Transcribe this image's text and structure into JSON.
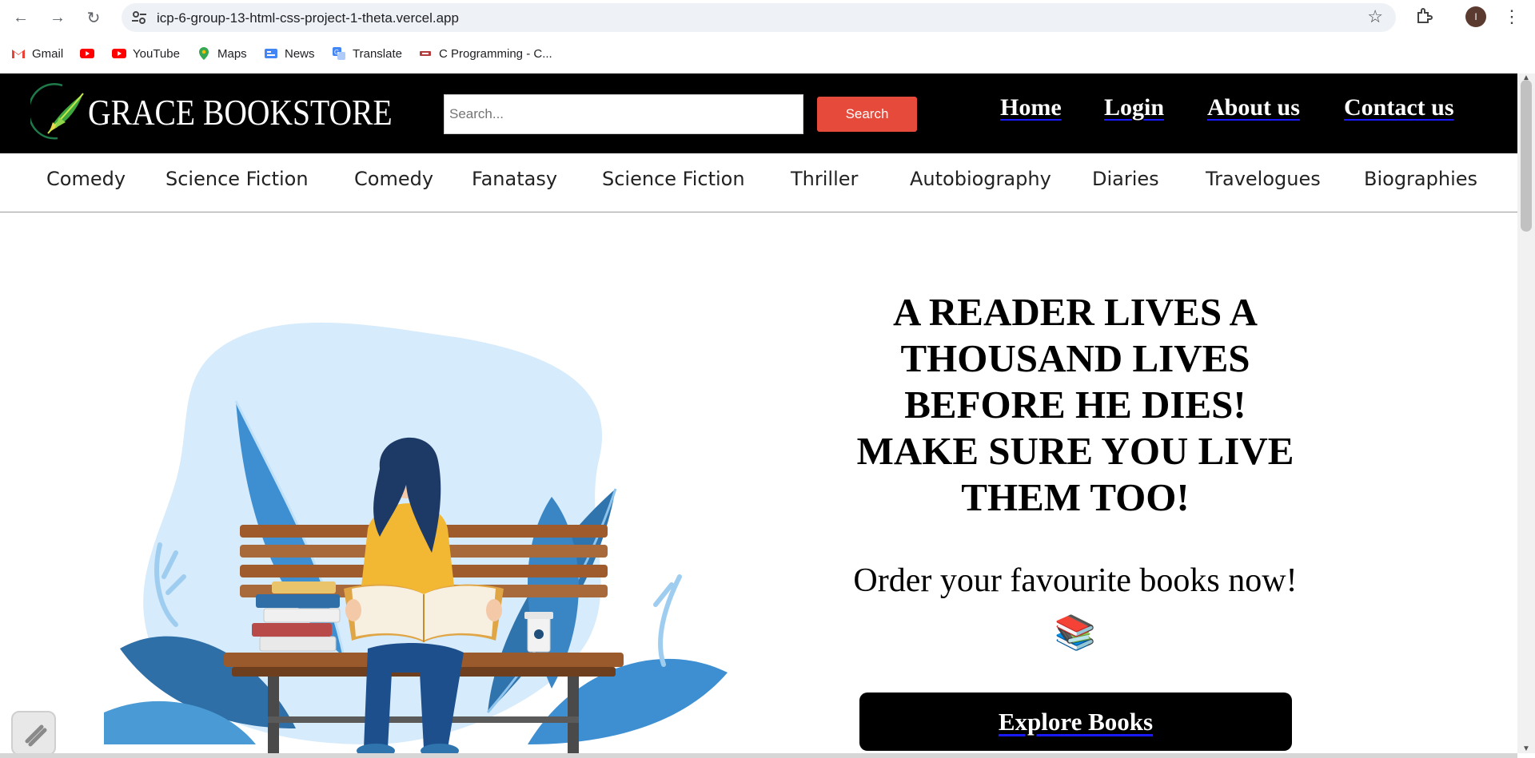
{
  "browser": {
    "url": "icp-6-group-13-html-css-project-1-theta.vercel.app",
    "avatar_initial": "I",
    "bookmarks": [
      {
        "label": "Gmail",
        "icon": "gmail-icon",
        "color": "#ea4335"
      },
      {
        "label": "",
        "icon": "youtube-icon",
        "color": "#ff0000"
      },
      {
        "label": "YouTube",
        "icon": "youtube-icon",
        "color": "#ff0000"
      },
      {
        "label": "Maps",
        "icon": "maps-icon",
        "color": "#34a853"
      },
      {
        "label": "News",
        "icon": "news-icon",
        "color": "#4285f4"
      },
      {
        "label": "Translate",
        "icon": "translate-icon",
        "color": "#4285f4"
      },
      {
        "label": "C Programming - C...",
        "icon": "c-programming-icon",
        "color": "#b23b3b"
      }
    ]
  },
  "header": {
    "brand": "GRACE BOOKSTORE",
    "search_placeholder": "Search...",
    "search_button": "Search",
    "nav": [
      "Home",
      "Login",
      "About us",
      "Contact us"
    ]
  },
  "categories": [
    "Comedy",
    "Science Fiction",
    "Comedy",
    "Fanatasy",
    "Science Fiction",
    "Thriller",
    "Autobiography",
    "Diaries",
    "Travelogues",
    "Biographies"
  ],
  "hero": {
    "quote": "A READER LIVES A THOUSAND LIVES BEFORE HE DIES! MAKE SURE YOU LIVE THEM TOO!",
    "order_text": "Order your favourite books now! 📚",
    "cta": "Explore Books"
  },
  "colors": {
    "header_bg": "#000000",
    "search_button": "#e64a3b",
    "link_underline": "#1a1aff"
  }
}
